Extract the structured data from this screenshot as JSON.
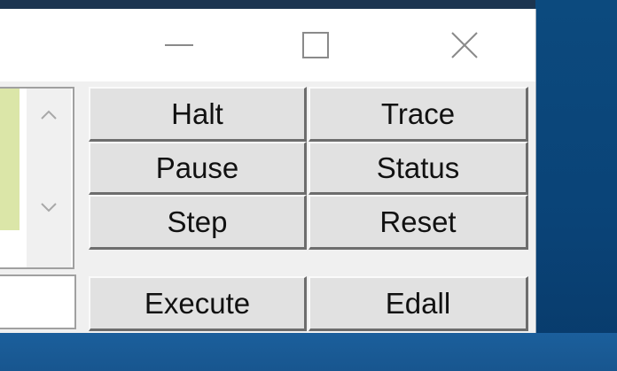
{
  "window": {
    "minimize_icon": "minimize-icon",
    "maximize_icon": "maximize-icon",
    "close_icon": "close-icon"
  },
  "scrollbar": {
    "up_icon": "chevron-up-icon",
    "down_icon": "chevron-down-icon"
  },
  "buttons": {
    "halt": "Halt",
    "trace": "Trace",
    "pause": "Pause",
    "status": "Status",
    "step": "Step",
    "reset": "Reset",
    "execute": "Execute",
    "edall": "Edall"
  },
  "colors": {
    "desktop": "#0c4a7e",
    "taskbar": "#1b5f9c",
    "button_face": "#e1e1e1",
    "list_highlight": "#dbe6a8"
  }
}
